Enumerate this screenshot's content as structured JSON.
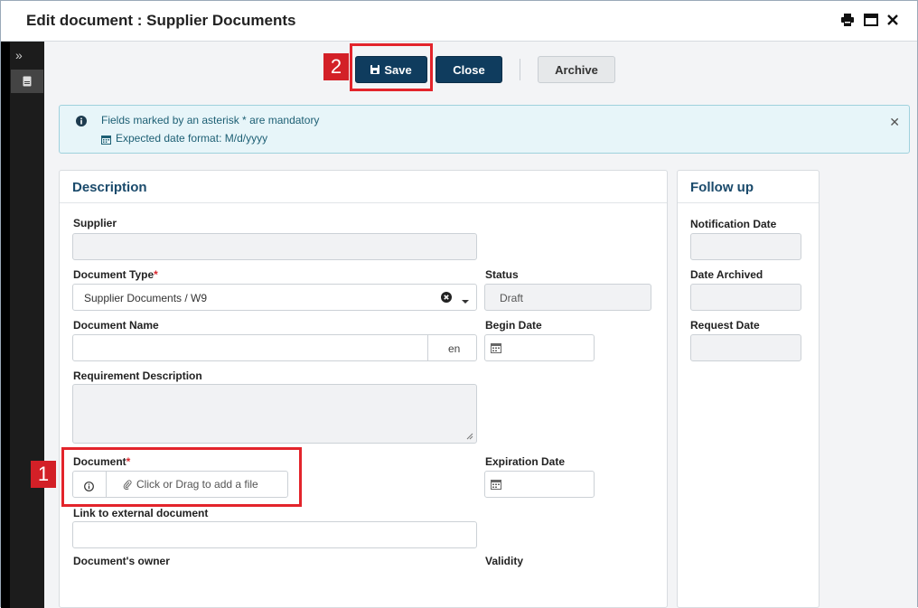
{
  "window": {
    "title": "Edit document : Supplier Documents"
  },
  "toolbar": {
    "save_label": "Save",
    "close_label": "Close",
    "archive_label": "Archive"
  },
  "callouts": {
    "one": "1",
    "two": "2"
  },
  "alert": {
    "line1": "Fields marked by an asterisk * are mandatory",
    "line2": "Expected date format: M/d/yyyy",
    "close": "✕"
  },
  "description": {
    "title": "Description",
    "supplier": {
      "label": "Supplier",
      "value": ""
    },
    "document_type": {
      "label": "Document Type",
      "value": "Supplier Documents / W9"
    },
    "status": {
      "label": "Status",
      "value": "Draft"
    },
    "document_name": {
      "label": "Document Name",
      "value": "",
      "lang": "en"
    },
    "begin_date": {
      "label": "Begin Date",
      "value": ""
    },
    "requirement_description": {
      "label": "Requirement Description",
      "value": ""
    },
    "document": {
      "label": "Document",
      "upload_text": "Click or Drag to add a file"
    },
    "expiration_date": {
      "label": "Expiration Date",
      "value": ""
    },
    "link_external": {
      "label": "Link to external document",
      "value": ""
    },
    "owner": {
      "label": "Document's owner"
    },
    "validity": {
      "label": "Validity"
    }
  },
  "followup": {
    "title": "Follow up",
    "notification_date": {
      "label": "Notification Date",
      "value": ""
    },
    "date_archived": {
      "label": "Date Archived",
      "value": ""
    },
    "request_date": {
      "label": "Request Date",
      "value": ""
    }
  },
  "required_marker": "*",
  "colors": {
    "primary": "#0f3c5e",
    "callout": "#d32027",
    "info_bg": "#e7f5f9",
    "title_blue": "#1a4a6b"
  },
  "icons": [
    "print-icon",
    "maximize-icon",
    "close-icon",
    "expand-icon",
    "document-icon",
    "info-icon",
    "calendar-icon",
    "save-icon",
    "clear-icon",
    "chevron-down-icon",
    "paperclip-icon"
  ]
}
